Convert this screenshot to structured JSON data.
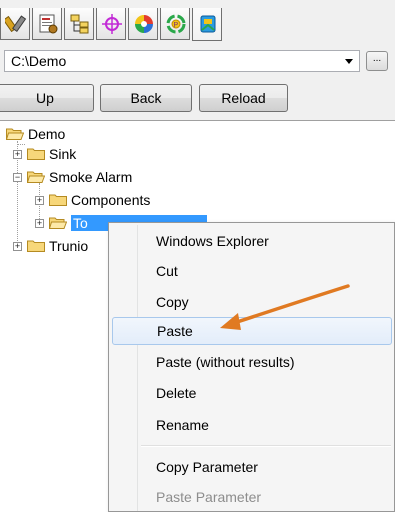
{
  "toolbar": {
    "buttons": [
      {
        "icon": "tools-icon"
      },
      {
        "icon": "document-settings-icon"
      },
      {
        "icon": "tree-structure-icon"
      },
      {
        "icon": "crosshair-icon"
      },
      {
        "icon": "color-wheel-icon"
      },
      {
        "icon": "recycle-icon"
      },
      {
        "icon": "publish-icon"
      }
    ]
  },
  "path": {
    "value": "C:\\Demo",
    "browse_label": "..."
  },
  "nav": {
    "up_label": "Up",
    "back_label": "Back",
    "reload_label": "Reload"
  },
  "tree": {
    "root": "Demo",
    "sink": "Sink",
    "smoke_alarm": "Smoke Alarm",
    "components": "Components",
    "selected_partial": "To",
    "trunion_partial": "Trunio"
  },
  "context_menu": {
    "items": [
      {
        "label": "Windows Explorer"
      },
      {
        "label": "Cut"
      },
      {
        "label": "Copy"
      },
      {
        "label": "Paste"
      },
      {
        "label": "Paste (without results)"
      },
      {
        "label": "Delete"
      },
      {
        "label": "Rename"
      },
      {
        "label": "Copy Parameter"
      },
      {
        "label": "Paste Parameter"
      }
    ]
  },
  "colors": {
    "selection": "#3399ff",
    "annotation_arrow": "#e07a22",
    "menu_hover": "#e3edfa"
  }
}
